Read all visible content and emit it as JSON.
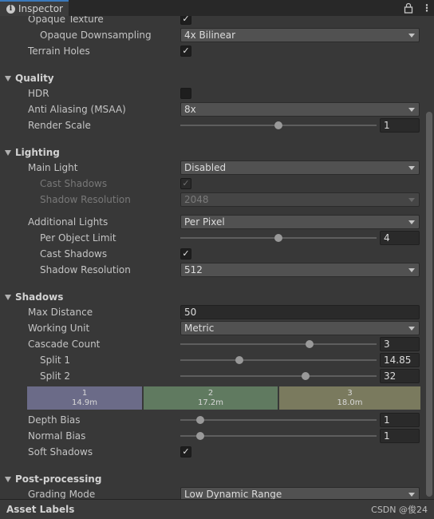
{
  "window": {
    "tab_label": "Inspector",
    "lock_icon": "lock-icon",
    "menu_icon": "kebab-menu-icon"
  },
  "rendering": {
    "opaque_texture": {
      "label": "Opaque Texture",
      "checked": true
    },
    "opaque_downsampling": {
      "label": "Opaque Downsampling",
      "value": "4x Bilinear"
    },
    "terrain_holes": {
      "label": "Terrain Holes",
      "checked": true
    }
  },
  "quality": {
    "title": "Quality",
    "hdr": {
      "label": "HDR",
      "checked": false
    },
    "msaa": {
      "label": "Anti Aliasing (MSAA)",
      "value": "8x"
    },
    "render_scale": {
      "label": "Render Scale",
      "value": "1",
      "fraction": 0.5
    }
  },
  "lighting": {
    "title": "Lighting",
    "main_light": {
      "label": "Main Light",
      "value": "Disabled"
    },
    "main_cast_shadows": {
      "label": "Cast Shadows",
      "checked": true
    },
    "main_shadow_resolution": {
      "label": "Shadow Resolution",
      "value": "2048"
    },
    "additional_lights": {
      "label": "Additional Lights",
      "value": "Per Pixel"
    },
    "per_object_limit": {
      "label": "Per Object Limit",
      "value": "4",
      "fraction": 0.5
    },
    "add_cast_shadows": {
      "label": "Cast Shadows",
      "checked": true
    },
    "add_shadow_resolution": {
      "label": "Shadow Resolution",
      "value": "512"
    }
  },
  "shadows": {
    "title": "Shadows",
    "max_distance": {
      "label": "Max Distance",
      "value": "50"
    },
    "working_unit": {
      "label": "Working Unit",
      "value": "Metric"
    },
    "cascade_count": {
      "label": "Cascade Count",
      "value": "3",
      "fraction": 0.66
    },
    "split1": {
      "label": "Split 1",
      "value": "14.85",
      "fraction": 0.3
    },
    "split2": {
      "label": "Split 2",
      "value": "32",
      "fraction": 0.64
    },
    "cascades": [
      {
        "index": "1",
        "distance": "14.9m",
        "color": "#6b6b88"
      },
      {
        "index": "2",
        "distance": "17.2m",
        "color": "#607a60"
      },
      {
        "index": "3",
        "distance": "18.0m",
        "color": "#7a7a5e"
      }
    ],
    "depth_bias": {
      "label": "Depth Bias",
      "value": "1",
      "fraction": 0.1
    },
    "normal_bias": {
      "label": "Normal Bias",
      "value": "1",
      "fraction": 0.1
    },
    "soft_shadows": {
      "label": "Soft Shadows",
      "checked": true
    }
  },
  "post_processing": {
    "title": "Post-processing",
    "grading_mode": {
      "label": "Grading Mode",
      "value": "Low Dynamic Range"
    }
  },
  "footer": {
    "title": "Asset Labels",
    "watermark": "CSDN @俊24"
  },
  "check_glyph": "✓"
}
